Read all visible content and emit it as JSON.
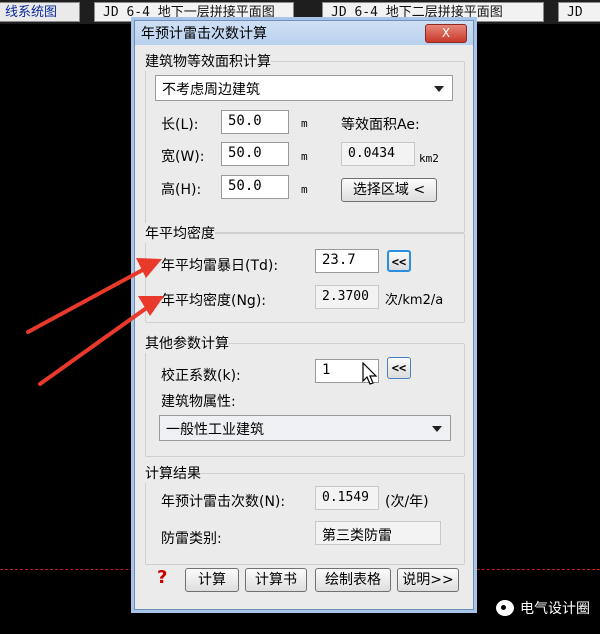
{
  "background_tabs": [
    {
      "label": "线系统图"
    },
    {
      "label": "JD 6-4 地下一层拼接平面图"
    },
    {
      "label": "JD 6-4 地下二层拼接平面图"
    },
    {
      "label": "JD"
    }
  ],
  "watermark": "电气设计圈",
  "dialog": {
    "title": "年预计雷击次数计算",
    "close_label": "X",
    "area_group": {
      "title": "建筑物等效面积计算",
      "mode_selected": "不考虑周边建筑",
      "length_label": "长(L):",
      "length_value": "50.0",
      "width_label": "宽(W):",
      "width_value": "50.0",
      "height_label": "高(H):",
      "height_value": "50.0",
      "unit_m": "m",
      "ae_label": "等效面积Ae:",
      "ae_value": "0.0434",
      "ae_unit": "km2",
      "select_region_label": "选择区域 <"
    },
    "density_group": {
      "title": "年平均密度",
      "td_label": "年平均雷暴日(Td):",
      "td_value": "23.7",
      "ng_label": "年平均密度(Ng):",
      "ng_value": "2.3700",
      "ng_unit": "次/km2/a",
      "pick_label": "<<"
    },
    "params_group": {
      "title": "其他参数计算",
      "k_label": "校正系数(k):",
      "k_value": "1",
      "pick_label": "<<",
      "attr_label": "建筑物属性:",
      "attr_selected": "一般性工业建筑"
    },
    "result_group": {
      "title": "计算结果",
      "n_label": "年预计雷击次数(N):",
      "n_value": "0.1549",
      "n_unit": "(次/年)",
      "class_label": "防雷类别:",
      "class_value": "第三类防雷"
    },
    "footer": {
      "help": "?",
      "calc_label": "计算",
      "report_label": "计算书",
      "table_label": "绘制表格",
      "explain_label": "说明>>"
    }
  },
  "colors": {
    "arrow": "#e8392b",
    "accent_border": "#2a8ee0"
  }
}
